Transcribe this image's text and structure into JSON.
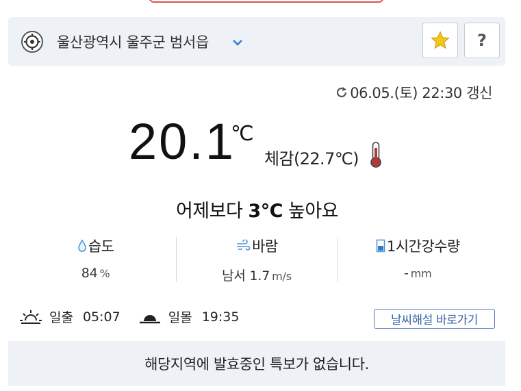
{
  "location": {
    "name": "울산광역시 울주군 범서읍"
  },
  "update": {
    "text": "06.05.(토) 22:30 갱신"
  },
  "current": {
    "temperature": "20.1",
    "unit": "℃",
    "feels_like": "체감(22.7℃)"
  },
  "compare": {
    "prefix": "어제보다 ",
    "value": "3℃",
    "suffix": " 높아요"
  },
  "stats": {
    "humidity": {
      "label": "습도",
      "value": "84",
      "unit": "%"
    },
    "wind": {
      "label": "바람",
      "value": "남서 1.7",
      "unit": "m/s"
    },
    "rain": {
      "label": "1시간강수량",
      "value": "-",
      "unit": "mm"
    }
  },
  "sun": {
    "sunrise_label": "일출",
    "sunrise_time": "05:07",
    "sunset_label": "일몰",
    "sunset_time": "19:35"
  },
  "guide_button": "날씨해설 바로가기",
  "alert": {
    "text": "해당지역에 발효중인 특보가 없습니다."
  },
  "colors": {
    "accent": "#3563a8",
    "star": "#f5c518",
    "thermo": "#b03a3a",
    "panel": "#eef1f6"
  },
  "icons": [
    "location-target-icon",
    "chevron-down-icon",
    "star-icon",
    "refresh-icon",
    "thermometer-icon",
    "droplet-icon",
    "wind-icon",
    "rain-gauge-icon",
    "sunrise-icon",
    "sunset-icon"
  ]
}
